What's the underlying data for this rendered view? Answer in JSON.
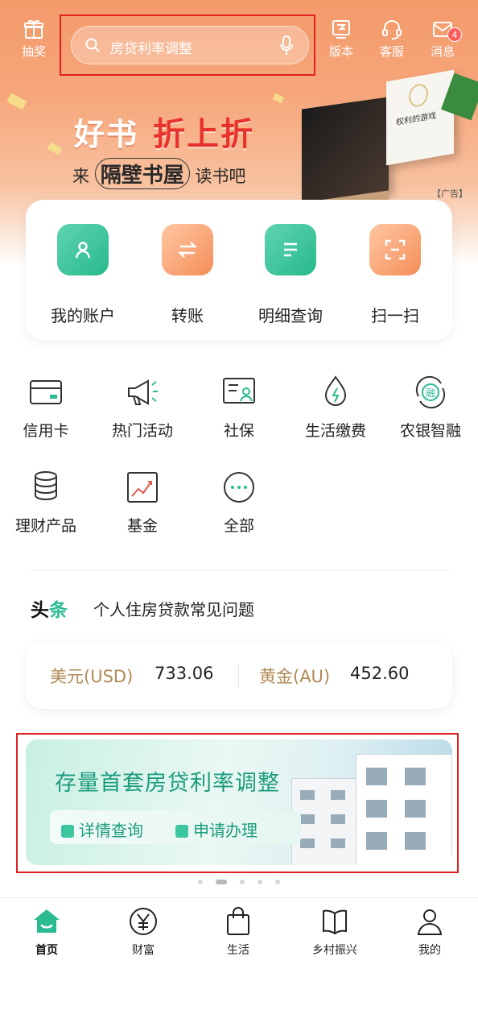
{
  "header": {
    "lottery_label": "抽奖",
    "search_placeholder": "房贷利率调整",
    "version_label": "版本",
    "service_label": "客服",
    "messages_label": "消息",
    "messages_badge": "4"
  },
  "banner": {
    "title_a": "好书",
    "title_b": "折上折",
    "sub_prefix": "来",
    "sub_highlight": "隔壁书屋",
    "sub_suffix": "读书吧",
    "book2_title": "权利的游戏",
    "ad_tag": "【广告】"
  },
  "quick_actions": [
    {
      "label": "我的账户",
      "icon": "account-icon",
      "color": "green"
    },
    {
      "label": "转账",
      "icon": "transfer-icon",
      "color": "orange"
    },
    {
      "label": "明细查询",
      "icon": "details-icon",
      "color": "green"
    },
    {
      "label": "扫一扫",
      "icon": "scan-icon",
      "color": "orange"
    }
  ],
  "services": [
    {
      "label": "信用卡",
      "icon": "credit-card-icon"
    },
    {
      "label": "热门活动",
      "icon": "megaphone-icon"
    },
    {
      "label": "社保",
      "icon": "social-security-icon"
    },
    {
      "label": "生活缴费",
      "icon": "utility-payment-icon"
    },
    {
      "label": "农银智融",
      "icon": "smart-finance-icon"
    },
    {
      "label": "理财产品",
      "icon": "wealth-products-icon"
    },
    {
      "label": "基金",
      "icon": "fund-chart-icon"
    },
    {
      "label": "全部",
      "icon": "more-icon"
    }
  ],
  "headlines": {
    "tag_a": "头",
    "tag_b": "条",
    "text": "个人住房贷款常见问题"
  },
  "rates": [
    {
      "name": "美元(USD)",
      "value": "733.06"
    },
    {
      "name": "黄金(AU)",
      "value": "452.60"
    }
  ],
  "promo": {
    "title": "存量首套房贷利率调整",
    "option_1": "详情查询",
    "option_2": "申请办理",
    "carousel_index": 2,
    "carousel_count": 5
  },
  "tabs": [
    {
      "label": "首页",
      "icon": "home-icon",
      "active": true
    },
    {
      "label": "财富",
      "icon": "yuan-icon",
      "active": false
    },
    {
      "label": "生活",
      "icon": "shopping-bag-icon",
      "active": false
    },
    {
      "label": "乡村振兴",
      "icon": "book-icon",
      "active": false
    },
    {
      "label": "我的",
      "icon": "profile-icon",
      "active": false
    }
  ],
  "colors": {
    "brand_green": "#2abb92",
    "accent_orange": "#f48e59",
    "highlight_red": "#e02020",
    "rate_gold": "#b08a55"
  }
}
